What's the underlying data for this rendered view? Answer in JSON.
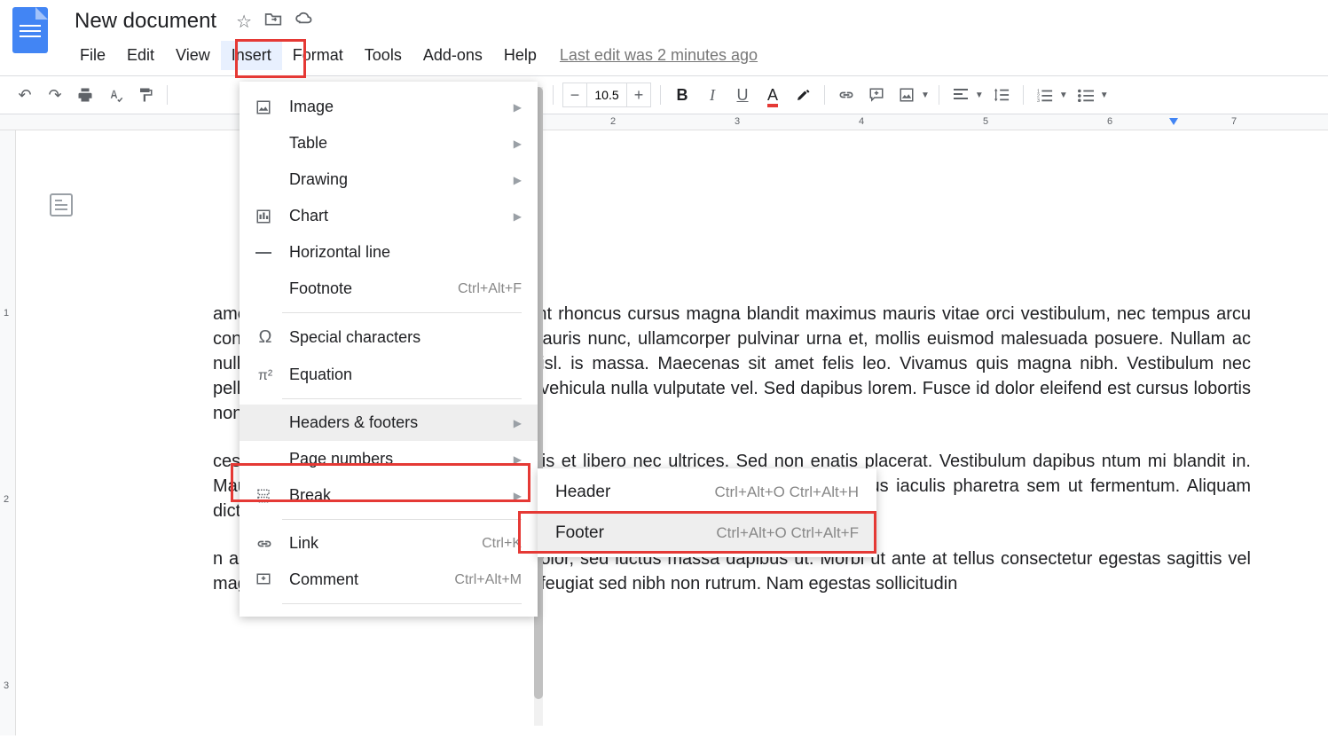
{
  "app": {
    "title": "New document",
    "last_edit": "Last edit was 2 minutes ago"
  },
  "menubar": [
    "File",
    "Edit",
    "View",
    "Insert",
    "Format",
    "Tools",
    "Add-ons",
    "Help"
  ],
  "active_menu_index": 3,
  "toolbar": {
    "fontsize": "10.5"
  },
  "ruler_marks": [
    "2",
    "3",
    "4",
    "5",
    "6",
    "7"
  ],
  "vruler_marks": [
    "1",
    "2",
    "3"
  ],
  "insert_menu": [
    {
      "icon": "image-icon",
      "label": "Image",
      "submenu": true
    },
    {
      "icon": "",
      "label": "Table",
      "submenu": true
    },
    {
      "icon": "",
      "label": "Drawing",
      "submenu": true
    },
    {
      "icon": "chart-icon",
      "label": "Chart",
      "submenu": true
    },
    {
      "icon": "hr-icon",
      "label": "Horizontal line"
    },
    {
      "icon": "",
      "label": "Footnote",
      "shortcut": "Ctrl+Alt+F"
    },
    {
      "divider": true
    },
    {
      "icon": "omega-icon",
      "label": "Special characters"
    },
    {
      "icon": "pi-icon",
      "label": "Equation"
    },
    {
      "divider": true
    },
    {
      "icon": "",
      "label": "Headers & footers",
      "submenu": true,
      "hovered": true
    },
    {
      "icon": "",
      "label": "Page numbers",
      "submenu": true
    },
    {
      "icon": "break-icon",
      "label": "Break",
      "submenu": true
    },
    {
      "divider": true
    },
    {
      "icon": "link-icon",
      "label": "Link",
      "shortcut": "Ctrl+K"
    },
    {
      "icon": "comment-icon",
      "label": "Comment",
      "shortcut": "Ctrl+Alt+M"
    },
    {
      "divider": true
    }
  ],
  "submenu": [
    {
      "label": "Header",
      "shortcut": "Ctrl+Alt+O Ctrl+Alt+H"
    },
    {
      "label": "Footer",
      "shortcut": "Ctrl+Alt+O Ctrl+Alt+F",
      "hovered": true
    }
  ],
  "document": {
    "p1": "amet, consectetur adipiscing elit. Praesent rhoncus cursus magna blandit maximus mauris vitae orci vestibulum, nec tempus arcu convallis. Praesent citur mattis. Donec mauris nunc, ullamcorper pulvinar urna et, mollis euismod malesuada posuere. Nullam ac nulla pharetra, finibus nisl id, sodales nisl. is massa. Maecenas sit amet felis leo. Vivamus quis magna nibh. Vestibulum nec pellentesque. Duis varius varius tortor, at vehicula nulla vulputate vel. Sed dapibus lorem. Fusce id dolor eleifend est cursus lobortis non eu leo.",
    "p2": "ces posuere cubilia curae; Vivamus iaculis et libero nec ultrices. Sed non enatis placerat. Vestibulum dapibus ntum mi blandit in. Mauris imperdiet scelerisque odio nec aliquet. Praesent vel eleifend urna. Vivamus iaculis pharetra sem ut fermentum. Aliquam dictum imperdiet. Sed eget lacinia lectus.",
    "p3": "n augue. Praesent malesuada vehicula dolor, sed luctus massa dapibus ut. Morbi ut ante at tellus consectetur egestas sagittis vel magna. Maecenas si in aliquam. Aliquam feugiat sed nibh non rutrum. Nam egestas sollicitudin"
  }
}
